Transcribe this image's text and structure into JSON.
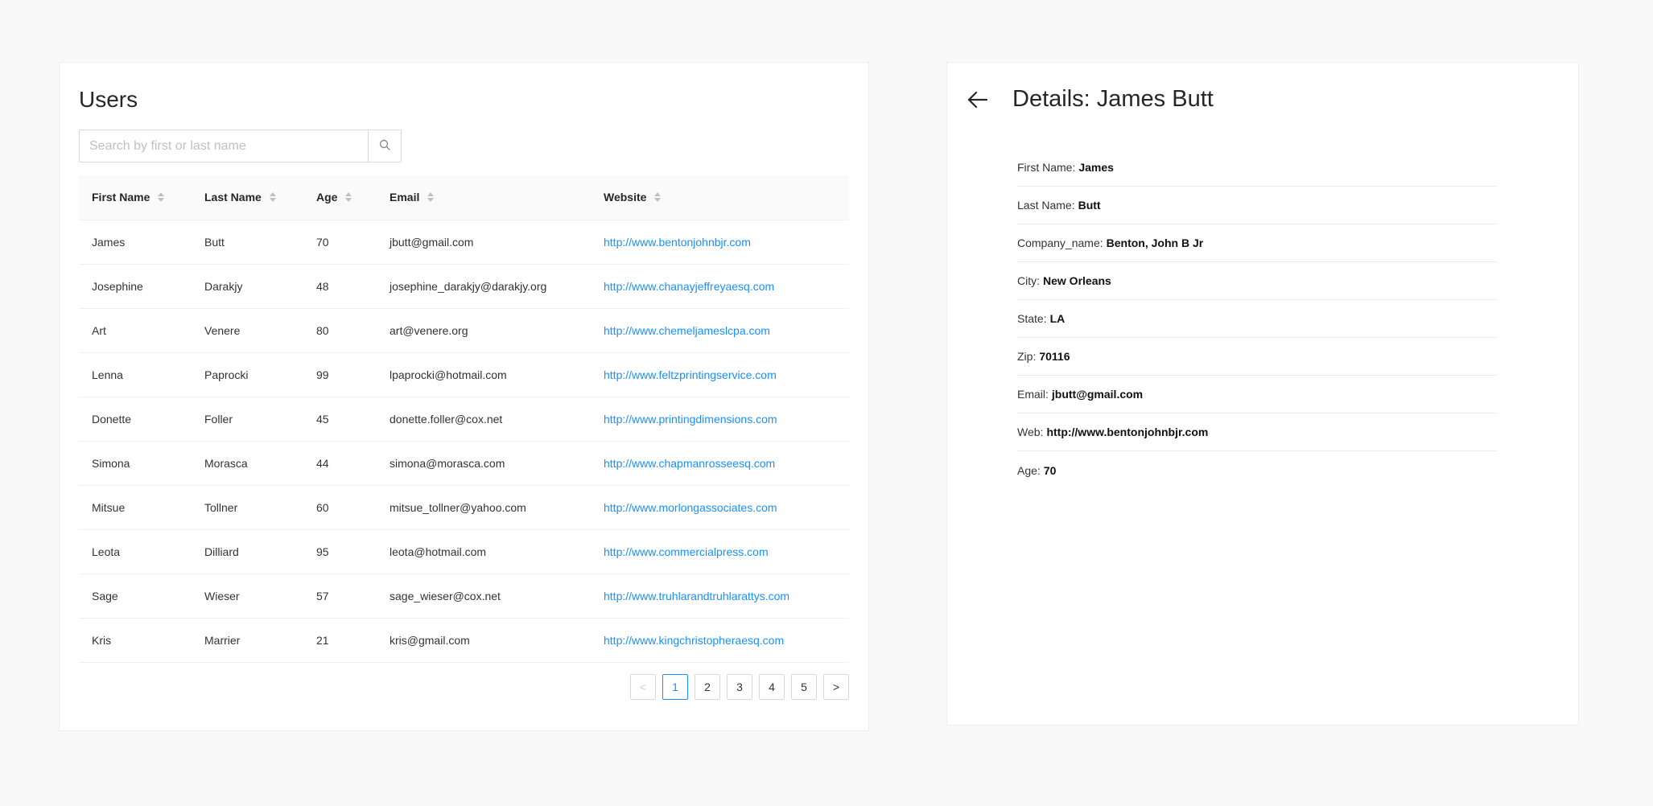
{
  "users": {
    "title": "Users",
    "search": {
      "placeholder": "Search by first or last name"
    },
    "columns": [
      "First Name",
      "Last Name",
      "Age",
      "Email",
      "Website"
    ],
    "rows": [
      [
        "James",
        "Butt",
        "70",
        "jbutt@gmail.com",
        "http://www.bentonjohnbjr.com"
      ],
      [
        "Josephine",
        "Darakjy",
        "48",
        "josephine_darakjy@darakjy.org",
        "http://www.chanayjeffreyaesq.com"
      ],
      [
        "Art",
        "Venere",
        "80",
        "art@venere.org",
        "http://www.chemeljameslcpa.com"
      ],
      [
        "Lenna",
        "Paprocki",
        "99",
        "lpaprocki@hotmail.com",
        "http://www.feltzprintingservice.com"
      ],
      [
        "Donette",
        "Foller",
        "45",
        "donette.foller@cox.net",
        "http://www.printingdimensions.com"
      ],
      [
        "Simona",
        "Morasca",
        "44",
        "simona@morasca.com",
        "http://www.chapmanrosseesq.com"
      ],
      [
        "Mitsue",
        "Tollner",
        "60",
        "mitsue_tollner@yahoo.com",
        "http://www.morlongassociates.com"
      ],
      [
        "Leota",
        "Dilliard",
        "95",
        "leota@hotmail.com",
        "http://www.commercialpress.com"
      ],
      [
        "Sage",
        "Wieser",
        "57",
        "sage_wieser@cox.net",
        "http://www.truhlarandtruhlarattys.com"
      ],
      [
        "Kris",
        "Marrier",
        "21",
        "kris@gmail.com",
        "http://www.kingchristopheraesq.com"
      ]
    ],
    "pagination": {
      "prev": "<",
      "next": ">",
      "pages": [
        "1",
        "2",
        "3",
        "4",
        "5"
      ],
      "current": "1"
    }
  },
  "details": {
    "title": "Details: James Butt",
    "fields": [
      {
        "label": "First Name:",
        "value": "James"
      },
      {
        "label": "Last Name:",
        "value": "Butt"
      },
      {
        "label": "Company_name:",
        "value": "Benton, John B Jr"
      },
      {
        "label": "City:",
        "value": "New Orleans"
      },
      {
        "label": "State:",
        "value": "LA"
      },
      {
        "label": "Zip:",
        "value": "70116"
      },
      {
        "label": "Email:",
        "value": "jbutt@gmail.com"
      },
      {
        "label": "Web:",
        "value": "http://www.bentonjohnbjr.com"
      },
      {
        "label": "Age:",
        "value": "70"
      }
    ]
  },
  "colors": {
    "accent": "#1890ff",
    "background": "#f9f9f9"
  },
  "icons": {
    "search": "search-icon",
    "back": "arrow-left-icon",
    "sort": "sort-icon"
  }
}
